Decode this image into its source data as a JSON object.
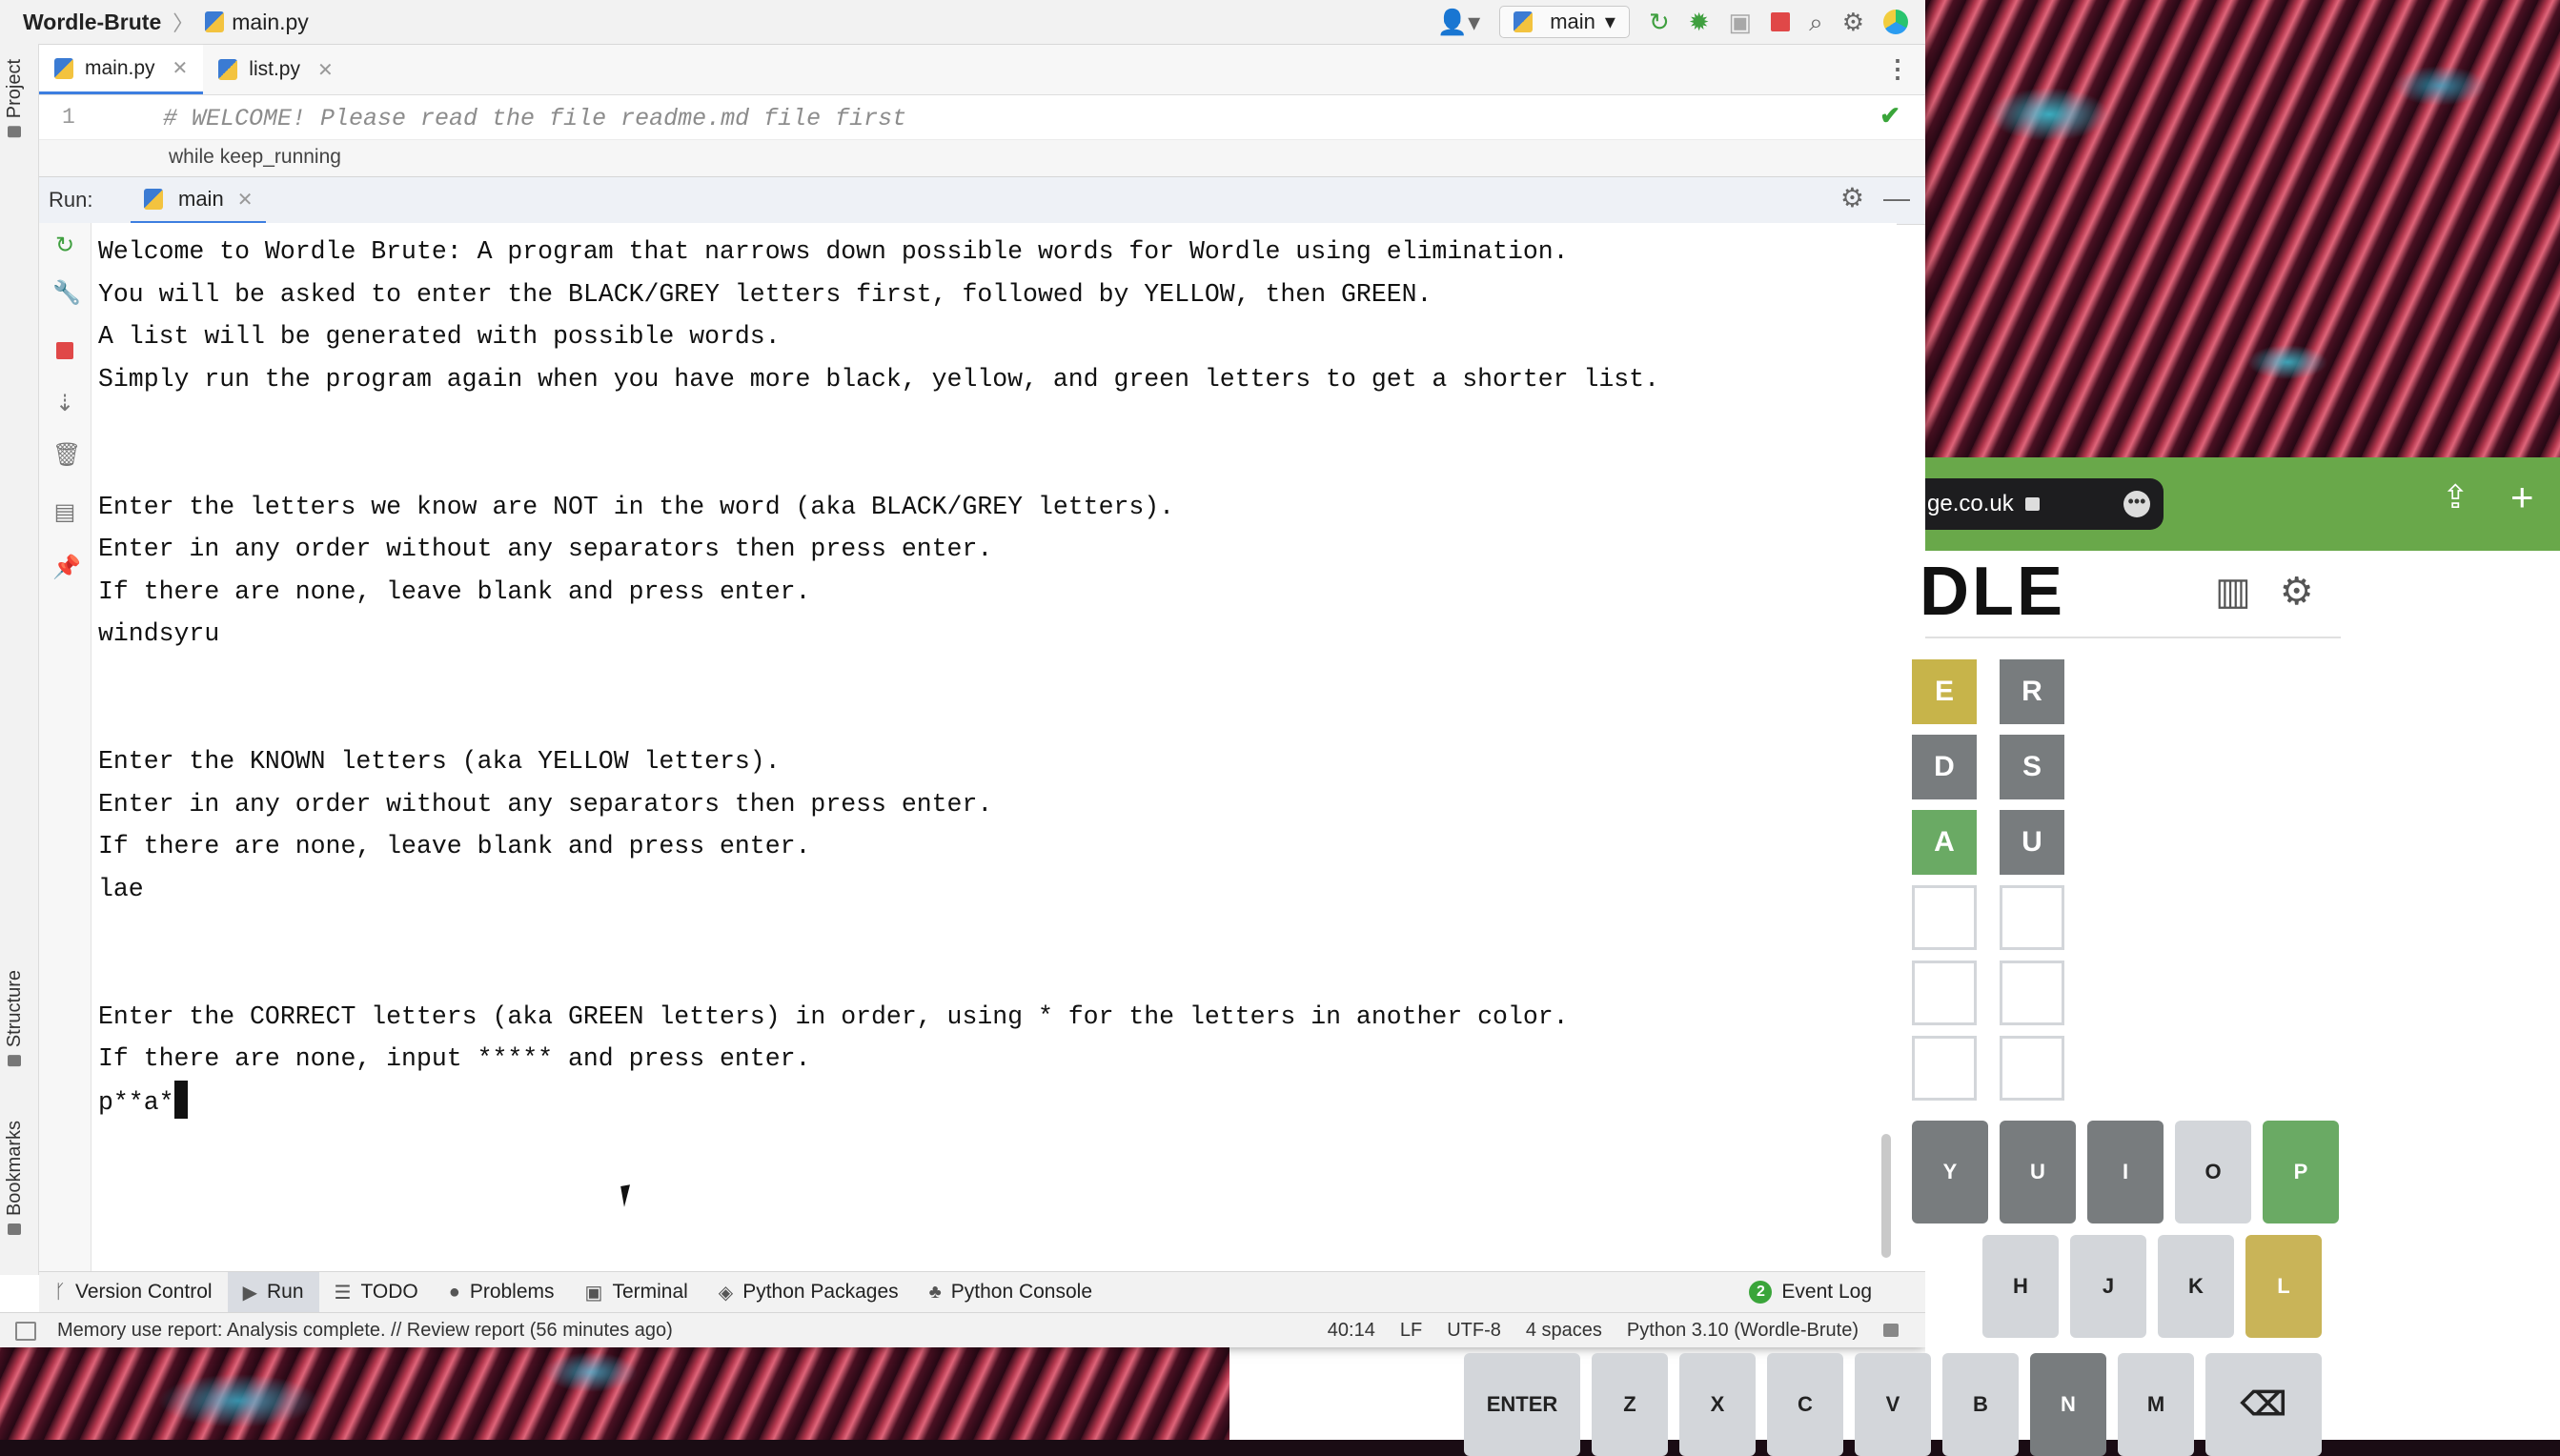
{
  "window": {
    "project": "Wordle-Brute",
    "file": "main.py",
    "run_config": "main"
  },
  "left_strip": {
    "project": "Project",
    "structure": "Structure",
    "bookmarks": "Bookmarks"
  },
  "tabs": [
    {
      "label": "main.py",
      "active": true
    },
    {
      "label": "list.py",
      "active": false
    }
  ],
  "editor": {
    "line_number": "1",
    "code": "# WELCOME! Please read the file readme.md file first",
    "breadcrumb": "while keep_running"
  },
  "run_panel": {
    "label": "Run:",
    "tab": "main"
  },
  "console": {
    "lines": [
      "Welcome to Wordle Brute: A program that narrows down possible words for Wordle using elimination.",
      "You will be asked to enter the BLACK/GREY letters first, followed by YELLOW, then GREEN.",
      "A list will be generated with possible words.",
      "Simply run the program again when you have more black, yellow, and green letters to get a shorter list.",
      "",
      "",
      "Enter the letters we know are NOT in the word (aka BLACK/GREY letters).",
      "Enter in any order without any separators then press enter.",
      "If there are none, leave blank and press enter.",
      "windsyru",
      "",
      "",
      "Enter the KNOWN letters (aka YELLOW letters).",
      "Enter in any order without any separators then press enter.",
      "If there are none, leave blank and press enter.",
      "lae",
      "",
      "",
      "Enter the CORRECT letters (aka GREEN letters) in order, using * for the letters in another color.",
      "If there are none, input ***** and press enter."
    ],
    "current_input": "p**a*"
  },
  "bottom_tools": [
    {
      "label": "Version Control",
      "icon": "branch-icon"
    },
    {
      "label": "Run",
      "icon": "play-icon"
    },
    {
      "label": "TODO",
      "icon": "list-icon"
    },
    {
      "label": "Problems",
      "icon": "info-icon"
    },
    {
      "label": "Terminal",
      "icon": "terminal-icon"
    },
    {
      "label": "Python Packages",
      "icon": "layers-icon"
    },
    {
      "label": "Python Console",
      "icon": "python-icon"
    }
  ],
  "event_log": {
    "label": "Event Log",
    "count": "2"
  },
  "statusbar": {
    "message": "Memory use report: Analysis complete. // Review report (56 minutes ago)",
    "position": "40:14",
    "line_sep": "LF",
    "encoding": "UTF-8",
    "indent": "4 spaces",
    "interpreter": "Python 3.10 (Wordle-Brute)"
  },
  "browser": {
    "url": "ge.co.uk",
    "title": "DLE",
    "colors": {
      "bar": "#69a84a",
      "yellow": "#c9b458",
      "gray": "#787c7e",
      "green": "#6aaa64"
    }
  },
  "board": [
    [
      {
        "letter": "E",
        "state": "yellow"
      },
      {
        "letter": "R",
        "state": "gray"
      }
    ],
    [
      {
        "letter": "D",
        "state": "gray"
      },
      {
        "letter": "S",
        "state": "gray"
      }
    ],
    [
      {
        "letter": "A",
        "state": "green"
      },
      {
        "letter": "U",
        "state": "gray"
      }
    ],
    [
      {
        "letter": "",
        "state": "empty"
      },
      {
        "letter": "",
        "state": "empty"
      }
    ],
    [
      {
        "letter": "",
        "state": "empty"
      },
      {
        "letter": "",
        "state": "empty"
      }
    ],
    [
      {
        "letter": "",
        "state": "empty"
      },
      {
        "letter": "",
        "state": "empty"
      }
    ]
  ],
  "keyboard": {
    "row1": [
      {
        "key": "Y",
        "state": "gray"
      },
      {
        "key": "U",
        "state": "gray"
      },
      {
        "key": "I",
        "state": "gray"
      },
      {
        "key": "O",
        "state": "unused"
      },
      {
        "key": "P",
        "state": "green"
      }
    ],
    "row2": [
      {
        "key": "H",
        "state": "unused"
      },
      {
        "key": "J",
        "state": "unused"
      },
      {
        "key": "K",
        "state": "unused"
      },
      {
        "key": "L",
        "state": "yellow"
      }
    ],
    "row3": [
      {
        "key": "ENTER",
        "state": "unused"
      },
      {
        "key": "Z",
        "state": "unused"
      },
      {
        "key": "X",
        "state": "unused"
      },
      {
        "key": "C",
        "state": "unused"
      },
      {
        "key": "V",
        "state": "unused"
      },
      {
        "key": "B",
        "state": "unused"
      },
      {
        "key": "N",
        "state": "gray"
      },
      {
        "key": "M",
        "state": "unused"
      },
      {
        "key": "⌫",
        "state": "unused"
      }
    ]
  }
}
